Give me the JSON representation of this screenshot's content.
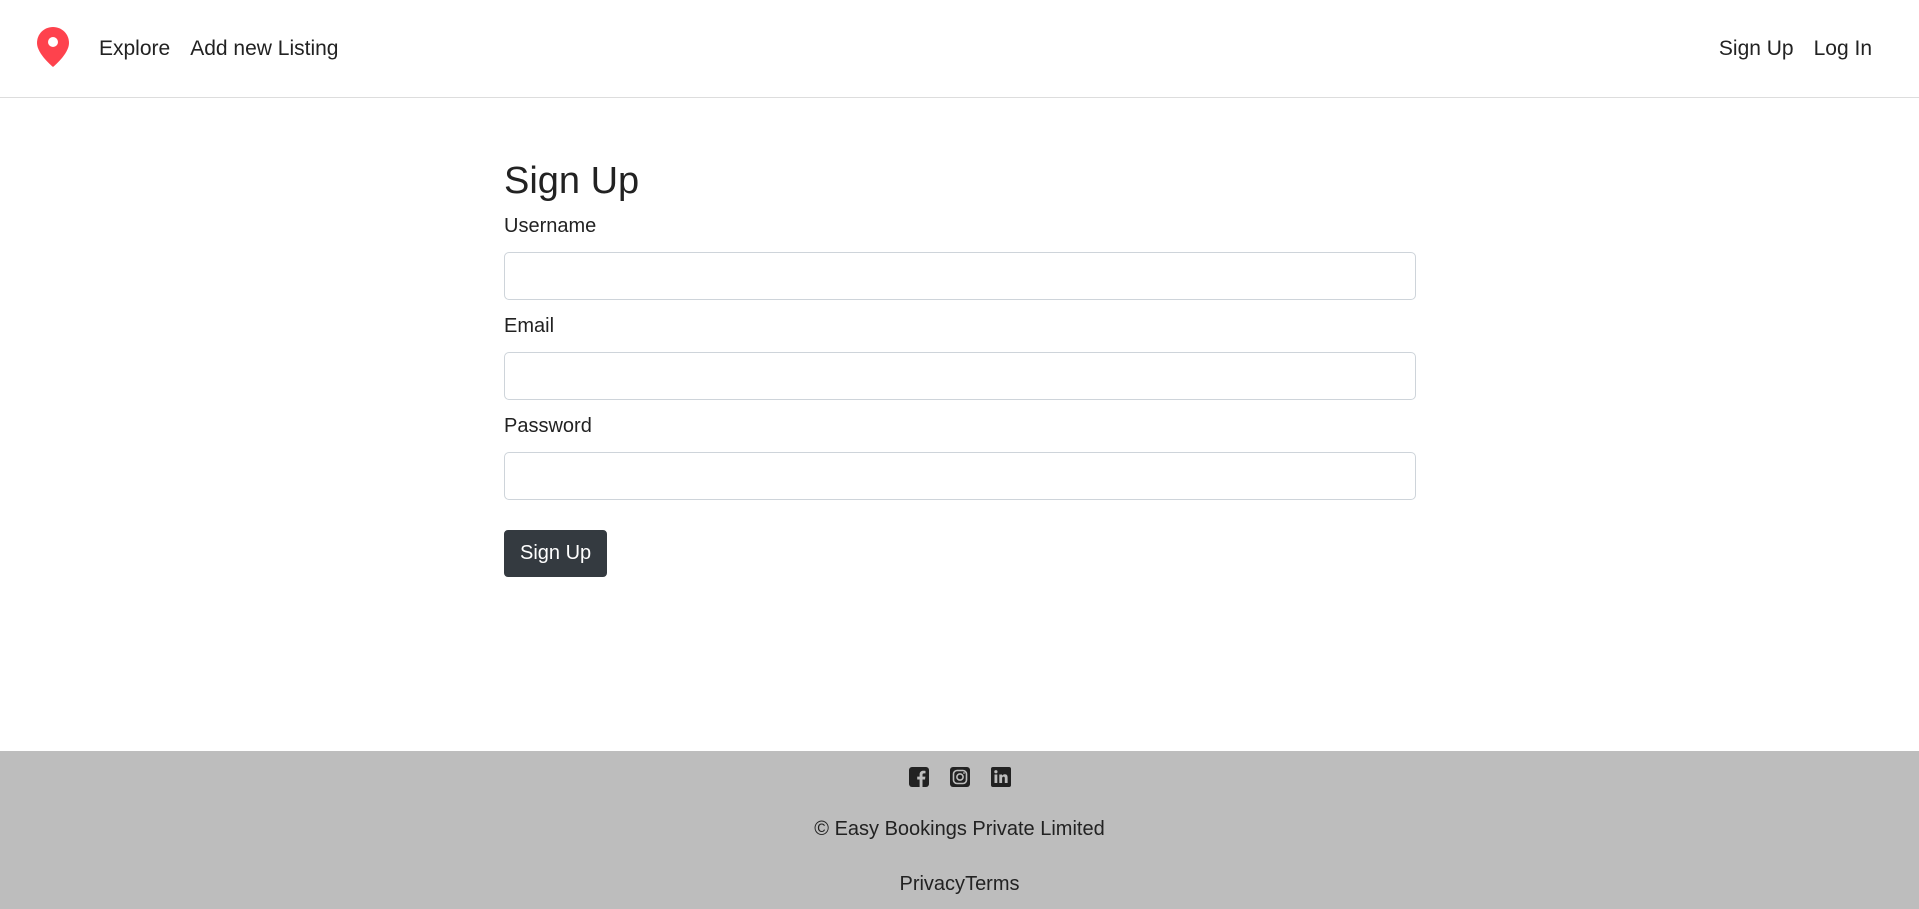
{
  "nav": {
    "brand_icon": "map-pin-icon",
    "brand_color": "#fe424d",
    "left_links": [
      "Explore",
      "Add new Listing"
    ],
    "right_links": [
      "Sign Up",
      "Log In"
    ]
  },
  "form": {
    "title": "Sign Up",
    "username_label": "Username",
    "username_value": "",
    "email_label": "Email",
    "email_value": "",
    "password_label": "Password",
    "password_value": "",
    "submit_label": "Sign Up",
    "button_color": "#343a40"
  },
  "footer": {
    "background": "#bdbdbd",
    "social_icons": [
      "facebook-icon",
      "instagram-icon",
      "linkedin-icon"
    ],
    "copyright": "© Easy Bookings Private Limited",
    "links": [
      "Privacy",
      "Terms"
    ]
  }
}
